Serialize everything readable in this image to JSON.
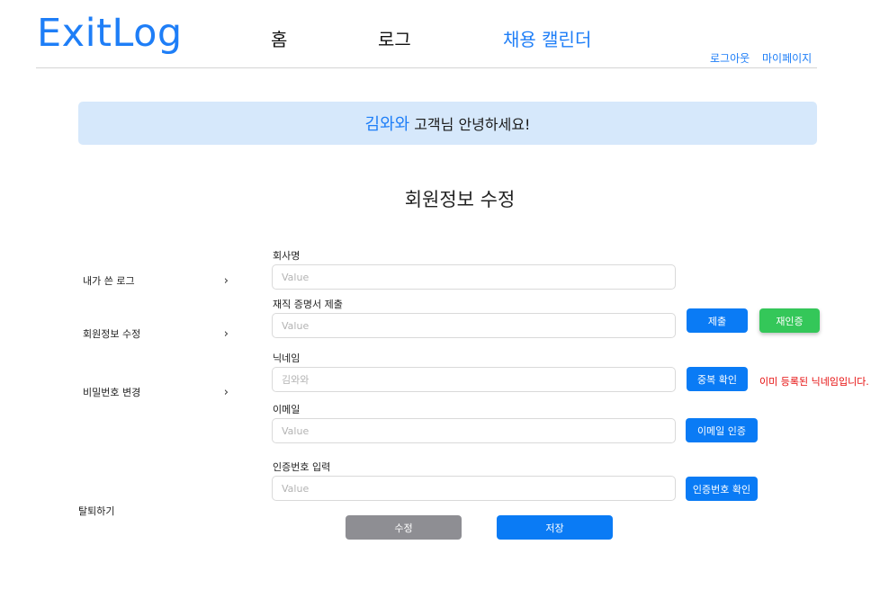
{
  "header": {
    "logo": "ExitLog",
    "nav": [
      "홈",
      "로그",
      "채용 캘린더"
    ],
    "logout": "로그아웃",
    "mypage": "마이페이지"
  },
  "greeting": {
    "name": "김와와",
    "suffix": "고객님 안녕하세요!"
  },
  "page_title": "회원정보 수정",
  "sidebar": {
    "items": [
      "내가 쓴 로그",
      "회원정보 수정",
      "비밀번호 변경"
    ],
    "chevron": "›",
    "withdraw": "탈퇴하기"
  },
  "form": {
    "company": {
      "label": "회사명",
      "placeholder": "Value"
    },
    "certificate": {
      "label": "재직 증명서 제출",
      "placeholder": "Value",
      "submit": "제출",
      "reverify": "재인증"
    },
    "nickname": {
      "label": "닉네임",
      "placeholder": "김와와",
      "check": "중복 확인",
      "error": "이미 등록된 닉네임입니다."
    },
    "email": {
      "label": "이메일",
      "placeholder": "Value",
      "verify": "이메일 인증"
    },
    "code": {
      "label": "인증번호 입력",
      "placeholder": "Value",
      "confirm": "인증번호 확인"
    },
    "edit": "수정",
    "save": "저장"
  }
}
